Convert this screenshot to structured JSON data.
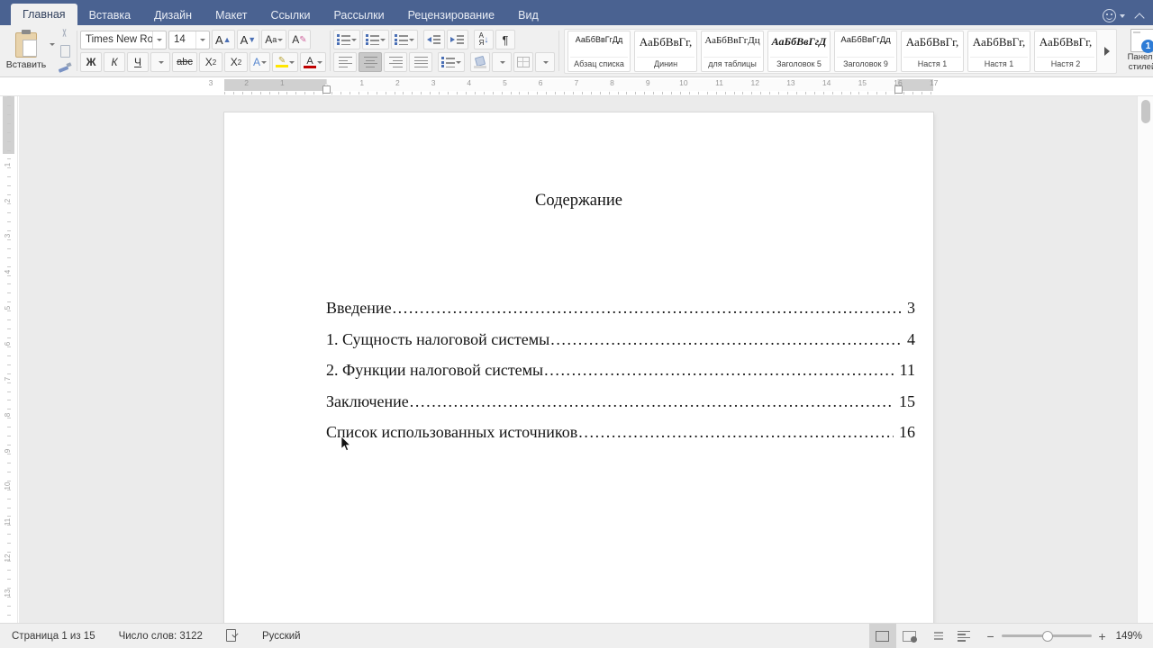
{
  "window": {
    "tabs": [
      {
        "label": "Главная",
        "active": true
      },
      {
        "label": "Вставка",
        "active": false
      },
      {
        "label": "Дизайн",
        "active": false
      },
      {
        "label": "Макет",
        "active": false
      },
      {
        "label": "Ссылки",
        "active": false
      },
      {
        "label": "Рассылки",
        "active": false
      },
      {
        "label": "Рецензирование",
        "active": false
      },
      {
        "label": "Вид",
        "active": false
      }
    ],
    "account_icon": "smiley-icon",
    "collapse_ribbon_icon": "chevron-up-icon"
  },
  "ribbon": {
    "clipboard": {
      "paste_label": "Вставить",
      "paste_icon": "clipboard-icon",
      "cut_icon": "scissors-icon",
      "copy_icon": "copy-icon",
      "format_painter_icon": "format-painter-icon"
    },
    "font": {
      "family_value": "Times New Ro...",
      "size_value": "14",
      "grow_font_icon": "grow-font-icon",
      "shrink_font_icon": "shrink-font-icon",
      "change_case_icon": "change-case-icon",
      "clear_formatting_icon": "clear-formatting-icon",
      "bold_label": "Ж",
      "italic_label": "К",
      "underline_label": "Ч",
      "strikethrough_label": "abc",
      "subscript_label": "X",
      "subscript_sub": "2",
      "superscript_label": "X",
      "superscript_sup": "2",
      "text_effects_icon": "text-effects-icon",
      "highlight_icon": "highlight-color-icon",
      "font_color_icon": "font-color-icon",
      "highlight_color": "#ffe600",
      "font_color": "#c00000"
    },
    "paragraph": {
      "bullets_icon": "bullet-list-icon",
      "numbering_icon": "numbered-list-icon",
      "multilevel_icon": "multilevel-list-icon",
      "decrease_indent_icon": "decrease-indent-icon",
      "increase_indent_icon": "increase-indent-icon",
      "sort_icon": "sort-icon",
      "show_marks_icon": "paragraph-marks-icon",
      "align_left_icon": "align-left-icon",
      "align_center_icon": "align-center-icon",
      "align_right_icon": "align-right-icon",
      "align_justify_icon": "align-justify-icon",
      "line_spacing_icon": "line-spacing-icon",
      "shading_icon": "shading-icon",
      "borders_icon": "borders-icon",
      "active_alignment": "align-center-icon"
    },
    "styles": {
      "items": [
        {
          "preview": "АаБбВвГгДд",
          "name": "Абзац списка"
        },
        {
          "preview": "АаБбВвГг,",
          "name": "Динин"
        },
        {
          "preview": "АаБбВвГгДц",
          "name": "для таблицы"
        },
        {
          "preview": "АаБбВвГгД",
          "name": "Заголовок 5"
        },
        {
          "preview": "АаБбВвГгДд",
          "name": "Заголовок 9"
        },
        {
          "preview": "АаБбВвГг,",
          "name": "Настя  1"
        },
        {
          "preview": "АаБбВвГг,",
          "name": "Настя 1"
        },
        {
          "preview": "АаБбВвГг,",
          "name": "Настя 2"
        }
      ],
      "more_icon": "gallery-more-icon",
      "panel_label_line1": "Панель",
      "panel_label_line2": "стилей",
      "panel_icon": "styles-panel-icon",
      "panel_badge": "1"
    }
  },
  "ruler": {
    "horizontal_labels": [
      "3",
      "2",
      "1",
      "1",
      "2",
      "3",
      "4",
      "5",
      "6",
      "7",
      "8",
      "9",
      "10",
      "11",
      "12",
      "13",
      "14",
      "15",
      "16",
      "17"
    ],
    "vertical_labels": [
      "2",
      "4",
      "1",
      "2",
      "3",
      "4",
      "5",
      "6",
      "7",
      "8",
      "9",
      "10",
      "11",
      "12"
    ],
    "left_indent_marker": "indent-marker",
    "right_indent_marker": "indent-marker"
  },
  "document": {
    "title": "Содержание",
    "toc": [
      {
        "text": "Введение ",
        "page": "3"
      },
      {
        "text": "1. Сущность налоговой системы ",
        "page": "4"
      },
      {
        "text": "2. Функции налоговой системы",
        "page": "11"
      },
      {
        "text": "Заключение",
        "page": "15"
      },
      {
        "text": "Список использованных источников",
        "page": "16"
      }
    ]
  },
  "status": {
    "page_info": "Страница 1 из 15",
    "word_count": "Число слов: 3122",
    "proofing_icon": "spell-check-icon",
    "language": "Русский",
    "view_read_icon": "read-mode-icon",
    "view_print_icon": "print-layout-icon",
    "view_web_icon": "web-layout-icon",
    "view_outline_icon": "outline-view-icon",
    "zoom_out_label": "−",
    "zoom_in_label": "+",
    "zoom_level": "149%"
  }
}
